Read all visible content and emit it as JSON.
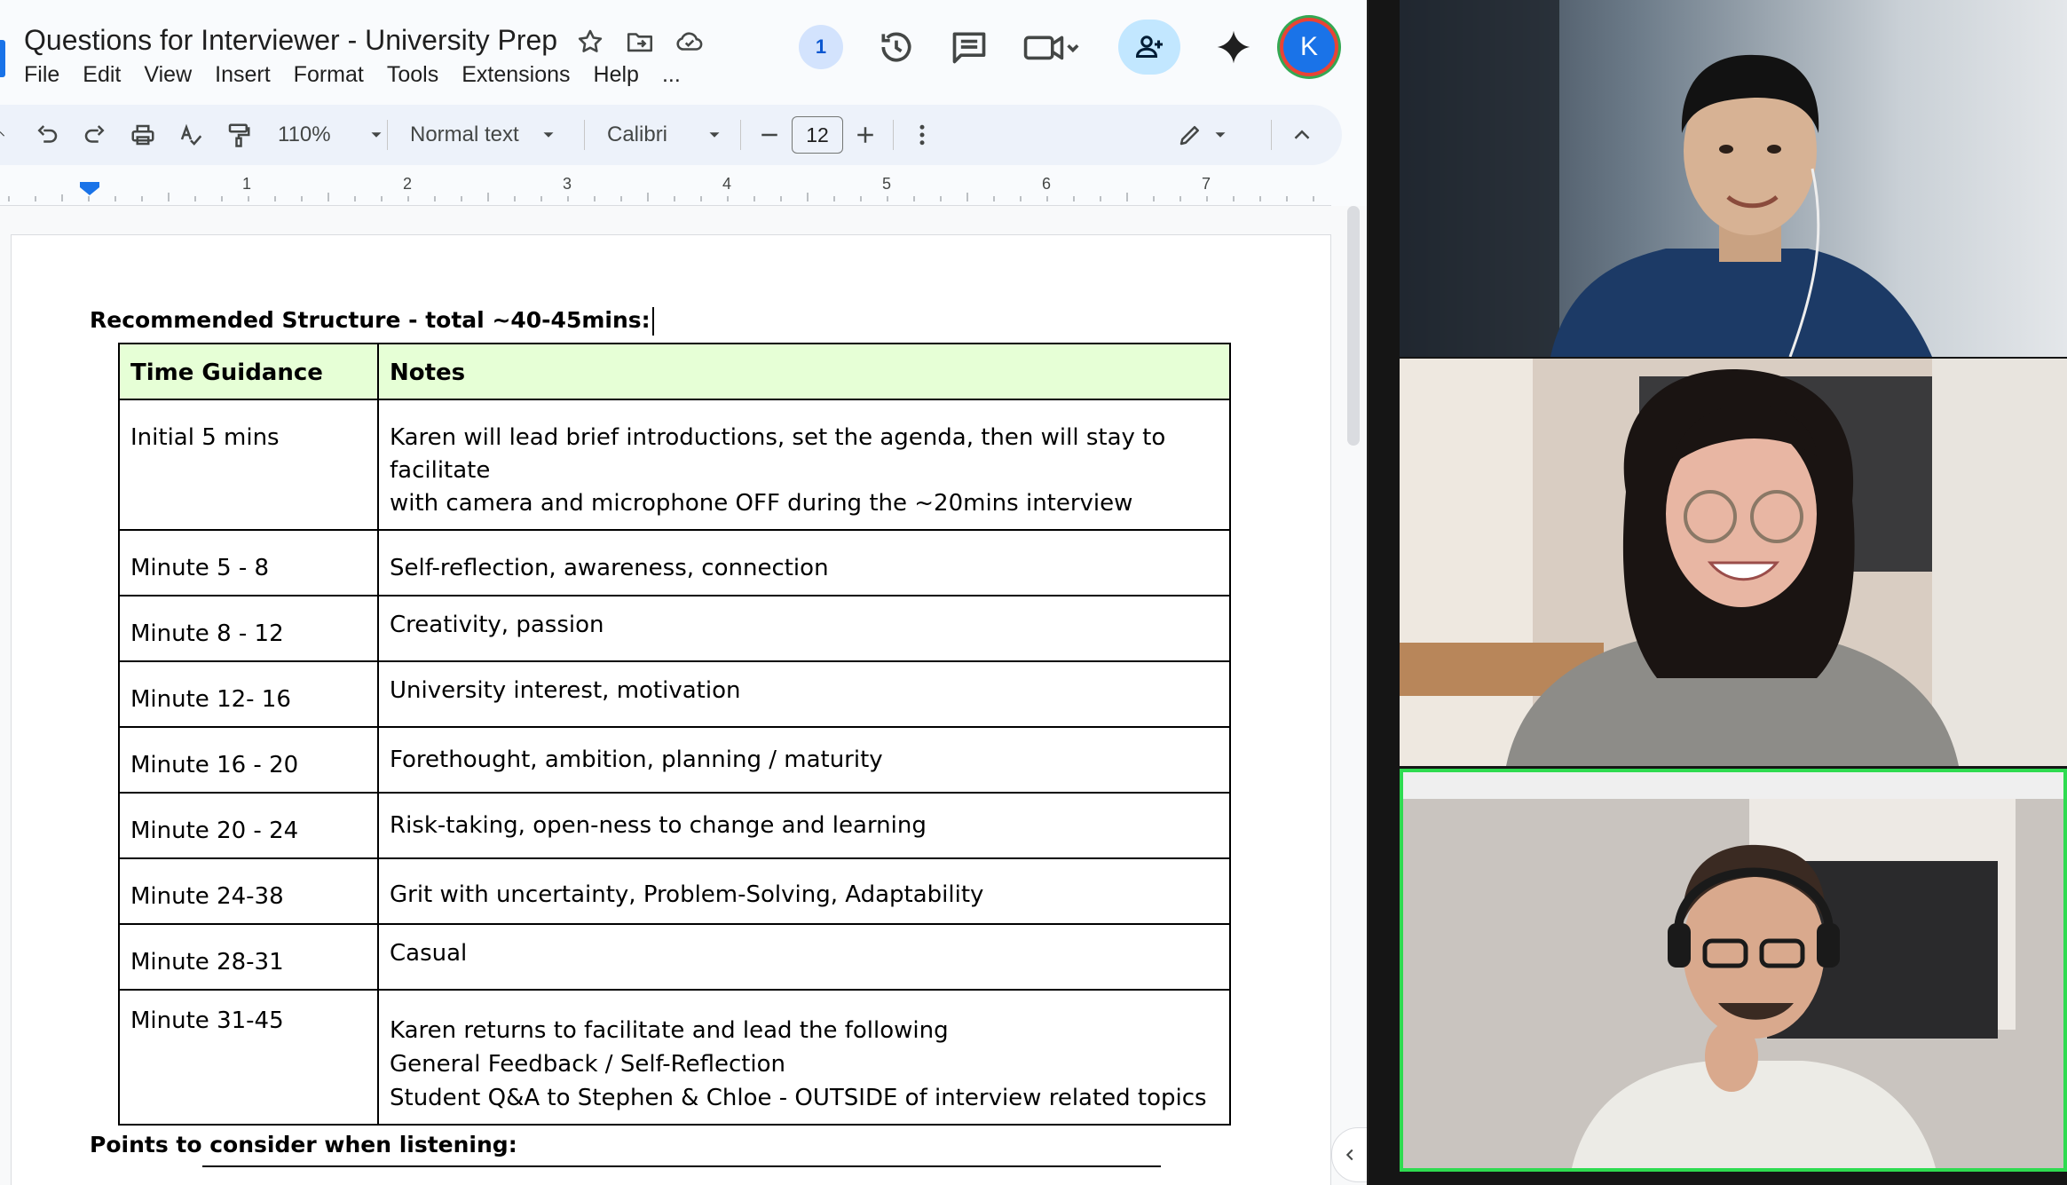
{
  "window": {
    "title": "Questions for Interviewer - University Prep",
    "menu": [
      "File",
      "Edit",
      "View",
      "Insert",
      "Format",
      "Tools",
      "Extensions",
      "Help",
      "..."
    ]
  },
  "header_right": {
    "viewer_count": "1",
    "avatar_initial": "K"
  },
  "toolbar": {
    "zoom": "110%",
    "style": "Normal text",
    "font": "Calibri",
    "font_size": "12"
  },
  "ruler": [
    "1",
    "2",
    "3",
    "4",
    "5",
    "6",
    "7"
  ],
  "document": {
    "heading1": "Recommended Structure - total ~40-45mins:",
    "table_headers": [
      "Time Guidance",
      "Notes"
    ],
    "rows": [
      {
        "time": "Initial 5 mins",
        "notes": [
          "Karen will lead brief introductions, set the agenda, then will stay to facilitate",
          "with camera and microphone OFF during the ~20mins interview"
        ]
      },
      {
        "time": "Minute 5 - 8",
        "notes": [
          "Self-reflection, awareness, connection"
        ]
      },
      {
        "time": "Minute 8 - 12",
        "notes": [
          "Creativity, passion"
        ]
      },
      {
        "time": "Minute 12- 16",
        "notes": [
          "University interest, motivation"
        ]
      },
      {
        "time": "Minute 16 - 20",
        "notes": [
          "Forethought, ambition, planning / maturity"
        ]
      },
      {
        "time": "Minute 20 - 24",
        "notes": [
          "Risk-taking, open-ness to change and learning"
        ]
      },
      {
        "time": "Minute 24-38",
        "notes": [
          "Grit with uncertainty, Problem-Solving, Adaptability"
        ]
      },
      {
        "time": "Minute 28-31",
        "notes": [
          "Casual"
        ]
      },
      {
        "time": "Minute 31-45",
        "notes": [
          "Karen returns to facilitate and lead the following",
          "General Feedback / Self-Reflection",
          "Student Q&A to Stephen & Chloe - OUTSIDE of interview related topics"
        ]
      }
    ],
    "heading2": "Points to consider when listening:"
  },
  "colors": {
    "header_fill": "#e6ffd6",
    "active_speaker_border": "#2edb50",
    "accent": "#1a73e8"
  }
}
